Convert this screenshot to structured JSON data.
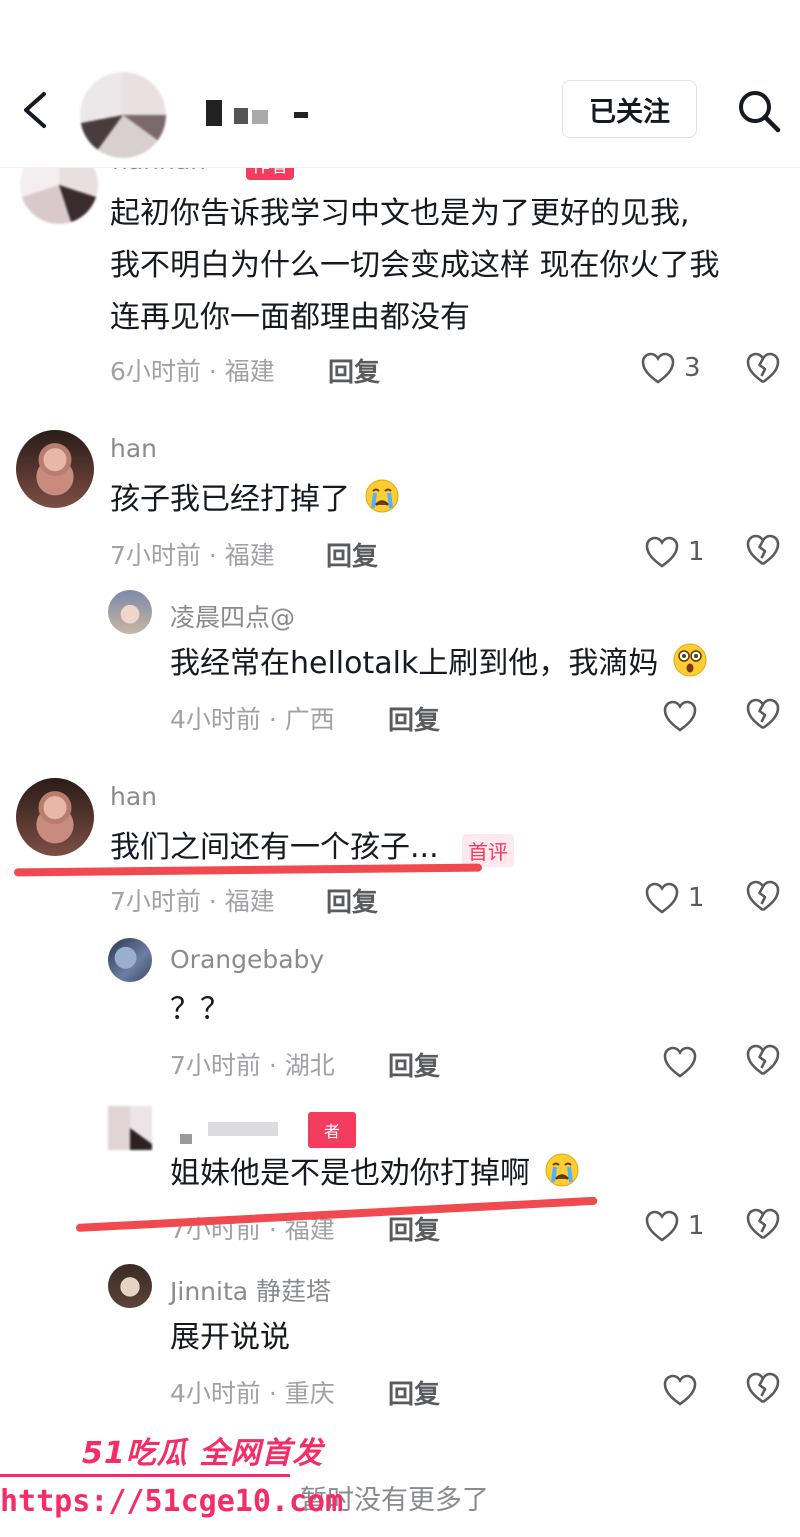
{
  "header": {
    "follow_label": "已关注",
    "icons": {
      "back": "chevron-left-icon",
      "search": "search-icon"
    }
  },
  "comments": [
    {
      "username": "hanhan",
      "author_tag": "作者",
      "lines": [
        "起初你告诉我学习中文也是为了更好的见我,",
        "我不明白为什么一切会变成这样 现在你火了我",
        "连再见你一面都理由都没有"
      ],
      "meta": "6小时前 · 福建",
      "reply_label": "回复",
      "likes": "3"
    },
    {
      "username": "han",
      "text": "孩子我已经打掉了",
      "emoji": "crying-face",
      "meta": "7小时前 · 福建",
      "reply_label": "回复",
      "likes": "1",
      "replies": [
        {
          "username": "凌晨四点@",
          "text": "我经常在hellotalk上刷到他，我滴妈",
          "emoji": "astonished-face",
          "meta": "4小时前 · 广西",
          "reply_label": "回复"
        }
      ]
    },
    {
      "username": "han",
      "text": "我们之间还有一个孩子...",
      "badge": "首评",
      "meta": "7小时前 · 福建",
      "reply_label": "回复",
      "likes": "1",
      "replies": [
        {
          "username": "Orangebaby",
          "text": "？？",
          "meta": "7小时前 · 湖北",
          "reply_label": "回复"
        },
        {
          "username": "",
          "author_tag": "者",
          "text": "姐妹他是不是也劝你打掉啊",
          "emoji": "crying-face",
          "meta": "7小时前 · 福建",
          "reply_label": "回复",
          "likes": "1"
        },
        {
          "username": "Jinnita 静莛塔",
          "text": "展开说说",
          "meta": "4小时前 · 重庆",
          "reply_label": "回复"
        }
      ]
    }
  ],
  "footer": {
    "text": "暂时没有更多了"
  },
  "watermark": {
    "title": "51吃瓜 全网首发",
    "url": "https://51cge10.com"
  },
  "colors": {
    "highlight_underline": "#f0494f",
    "watermark": "#f52c65",
    "badge": "#f03a5f"
  }
}
